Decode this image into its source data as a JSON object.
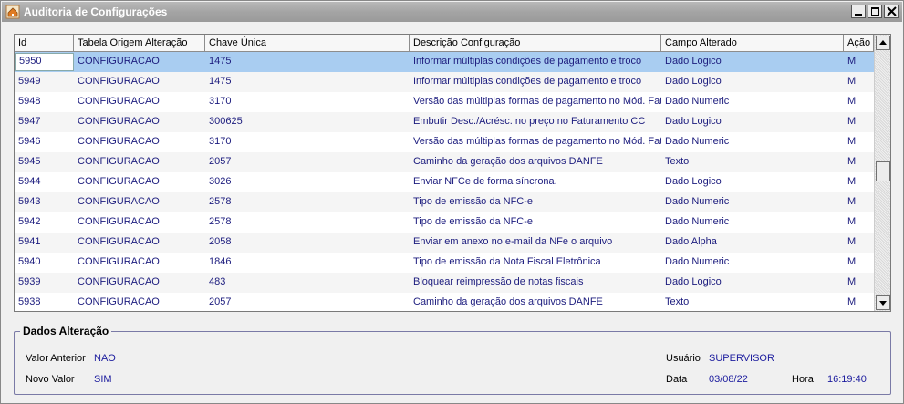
{
  "window": {
    "title": "Auditoria de Configurações",
    "icon": "app-icon",
    "controls": [
      "minimize-icon",
      "maximize-icon",
      "close-icon"
    ]
  },
  "grid": {
    "columns": [
      "Id",
      "Tabela Origem Alteração",
      "Chave Única",
      "Descrição Configuração",
      "Campo Alterado",
      "Ação"
    ],
    "rows": [
      [
        "5950",
        "CONFIGURACAO",
        "1475",
        "Informar múltiplas condições de pagamento e troco",
        "Dado Logico",
        "M"
      ],
      [
        "5949",
        "CONFIGURACAO",
        "1475",
        "Informar múltiplas condições de pagamento e troco",
        "Dado Logico",
        "M"
      ],
      [
        "5948",
        "CONFIGURACAO",
        "3170",
        "Versão das múltiplas formas de pagamento no Mód. Faturamento",
        "Dado Numeric",
        "M"
      ],
      [
        "5947",
        "CONFIGURACAO",
        "300625",
        "Embutir Desc./Acrésc. no preço no Faturamento CC",
        "Dado Logico",
        "M"
      ],
      [
        "5946",
        "CONFIGURACAO",
        "3170",
        "Versão das múltiplas formas de pagamento no Mód. Faturamento",
        "Dado Numeric",
        "M"
      ],
      [
        "5945",
        "CONFIGURACAO",
        "2057",
        "Caminho da geração dos arquivos DANFE",
        "Texto",
        "M"
      ],
      [
        "5944",
        "CONFIGURACAO",
        "3026",
        "Enviar NFCe de forma síncrona.",
        "Dado Logico",
        "M"
      ],
      [
        "5943",
        "CONFIGURACAO",
        "2578",
        "Tipo de emissão da NFC-e",
        "Dado Numeric",
        "M"
      ],
      [
        "5942",
        "CONFIGURACAO",
        "2578",
        "Tipo de emissão da NFC-e",
        "Dado Numeric",
        "M"
      ],
      [
        "5941",
        "CONFIGURACAO",
        "2058",
        "Enviar em anexo no e-mail da NFe o arquivo",
        "Dado Alpha",
        "M"
      ],
      [
        "5940",
        "CONFIGURACAO",
        "1846",
        "Tipo de emissão da Nota Fiscal Eletrônica",
        "Dado Numeric",
        "M"
      ],
      [
        "5939",
        "CONFIGURACAO",
        "483",
        "Bloquear reimpressão de notas fiscais",
        "Dado Logico",
        "M"
      ],
      [
        "5938",
        "CONFIGURACAO",
        "2057",
        "Caminho da geração dos arquivos DANFE",
        "Texto",
        "M"
      ]
    ],
    "selected_row": 0
  },
  "details": {
    "legend": "Dados Alteração",
    "valor_anterior_label": "Valor Anterior",
    "valor_anterior": "NAO",
    "novo_valor_label": "Novo Valor",
    "novo_valor": "SIM",
    "usuario_label": "Usuário",
    "usuario": "SUPERVISOR",
    "data_label": "Data",
    "data": "03/08/22",
    "hora_label": "Hora",
    "hora": "16:19:40"
  },
  "colors": {
    "selected_row": "#a9cdf1",
    "cell_text": "#1c1c7e",
    "title_bar": "#a4a4a4"
  }
}
